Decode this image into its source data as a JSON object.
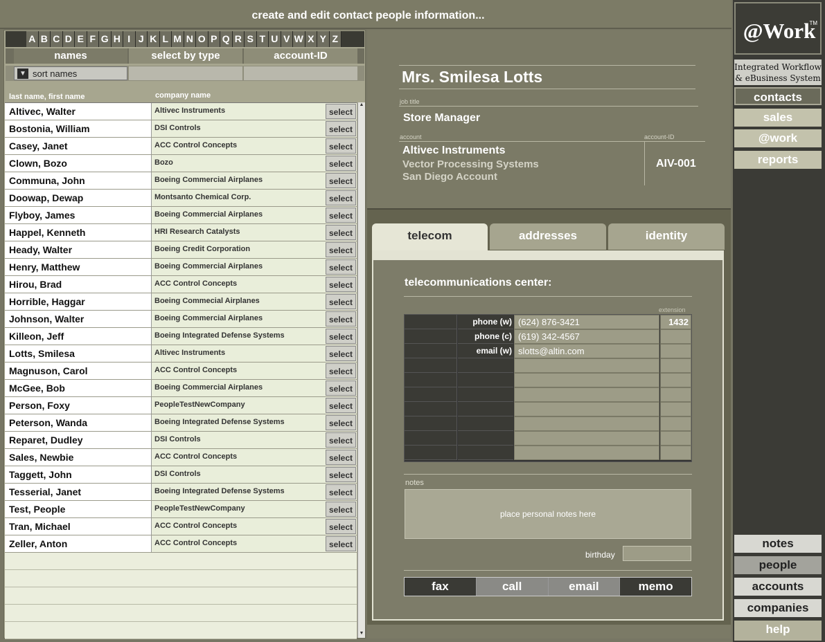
{
  "header": {
    "title": "create and edit contact people information..."
  },
  "alphabet": [
    "A",
    "B",
    "C",
    "D",
    "E",
    "F",
    "G",
    "H",
    "I",
    "J",
    "K",
    "L",
    "M",
    "N",
    "O",
    "P",
    "Q",
    "R",
    "S",
    "T",
    "U",
    "V",
    "W",
    "X",
    "Y",
    "Z"
  ],
  "list_tabs": {
    "names": "names",
    "type": "select by type",
    "account": "account-ID"
  },
  "sort": {
    "label": "sort names"
  },
  "columns": {
    "name": "last name,  first name",
    "company": "company name"
  },
  "select_label": "select",
  "contacts": [
    {
      "name": "Altivec, Walter",
      "company": "Altivec Instruments"
    },
    {
      "name": "Bostonia, William",
      "company": "DSI Controls"
    },
    {
      "name": "Casey, Janet",
      "company": "ACC Control Concepts"
    },
    {
      "name": "Clown, Bozo",
      "company": "Bozo"
    },
    {
      "name": "Communa, John",
      "company": "Boeing Commercial Airplanes"
    },
    {
      "name": "Doowap, Dewap",
      "company": "Montsanto Chemical Corp."
    },
    {
      "name": "Flyboy, James",
      "company": "Boeing Commercial Airplanes"
    },
    {
      "name": "Happel, Kenneth",
      "company": "HRI Research Catalysts"
    },
    {
      "name": "Heady, Walter",
      "company": "Boeing Credit Corporation"
    },
    {
      "name": "Henry, Matthew",
      "company": "Boeing Commercial Airplanes"
    },
    {
      "name": "Hirou, Brad",
      "company": "ACC Control Concepts"
    },
    {
      "name": "Horrible, Haggar",
      "company": "Boeing Commecial Airplanes"
    },
    {
      "name": "Johnson, Walter",
      "company": "Boeing Commercial Airplanes"
    },
    {
      "name": "Killeon, Jeff",
      "company": "Boeing Integrated Defense Systems"
    },
    {
      "name": "Lotts, Smilesa",
      "company": "Altivec Instruments"
    },
    {
      "name": "Magnuson, Carol",
      "company": "ACC Control Concepts"
    },
    {
      "name": "McGee, Bob",
      "company": "Boeing Commercial Airplanes"
    },
    {
      "name": "Person, Foxy",
      "company": "PeopleTestNewCompany"
    },
    {
      "name": "Peterson, Wanda",
      "company": "Boeing Integrated Defense Systems"
    },
    {
      "name": "Reparet, Dudley",
      "company": "DSI Controls"
    },
    {
      "name": "Sales, Newbie",
      "company": "ACC Control Concepts"
    },
    {
      "name": "Taggett, John",
      "company": "DSI Controls"
    },
    {
      "name": "Tesserial, Janet",
      "company": "Boeing Integrated Defense Systems"
    },
    {
      "name": "Test, People",
      "company": "PeopleTestNewCompany"
    },
    {
      "name": "Tran, Michael",
      "company": "ACC Control Concepts"
    },
    {
      "name": "Zeller, Anton",
      "company": "ACC Control Concepts"
    }
  ],
  "card": {
    "full_name": "Mrs. Smilesa Lotts",
    "job_title_label": "job title",
    "job_title": "Store Manager",
    "account_label": "account",
    "account_id_label": "account-ID",
    "account_lines": [
      "Altivec Instruments",
      "Vector Processing Systems",
      "San Diego Account"
    ],
    "account_id": "AIV-001"
  },
  "detail_tabs": {
    "telecom": "telecom",
    "addresses": "addresses",
    "identity": "identity"
  },
  "telecom": {
    "heading": "telecommunications center:",
    "extension_label": "extension",
    "rows": [
      {
        "label": "phone (w)",
        "value": "(624) 876-3421",
        "ext": "1432"
      },
      {
        "label": "phone (c)",
        "value": "(619) 342-4567",
        "ext": ""
      },
      {
        "label": "email (w)",
        "value": "slotts@altin.com",
        "ext": ""
      },
      {
        "label": "",
        "value": "",
        "ext": ""
      },
      {
        "label": "",
        "value": "",
        "ext": ""
      },
      {
        "label": "",
        "value": "",
        "ext": ""
      },
      {
        "label": "",
        "value": "",
        "ext": ""
      },
      {
        "label": "",
        "value": "",
        "ext": ""
      },
      {
        "label": "",
        "value": "",
        "ext": ""
      },
      {
        "label": "",
        "value": "",
        "ext": ""
      }
    ],
    "notes_label": "notes",
    "notes_placeholder": "place personal notes here",
    "birthday_label": "birthday",
    "actions": {
      "fax": "fax",
      "call": "call",
      "email": "email",
      "memo": "memo"
    }
  },
  "brand": {
    "logo": "@Work",
    "tm": "TM",
    "tagline_1": "Integrated Workflow",
    "tagline_2": "& eBusiness System"
  },
  "nav": {
    "contacts": "contacts",
    "sales": "sales",
    "work": "@work",
    "reports": "reports",
    "notes": "notes",
    "people": "people",
    "accounts": "accounts",
    "companies": "companies",
    "help": "help"
  }
}
